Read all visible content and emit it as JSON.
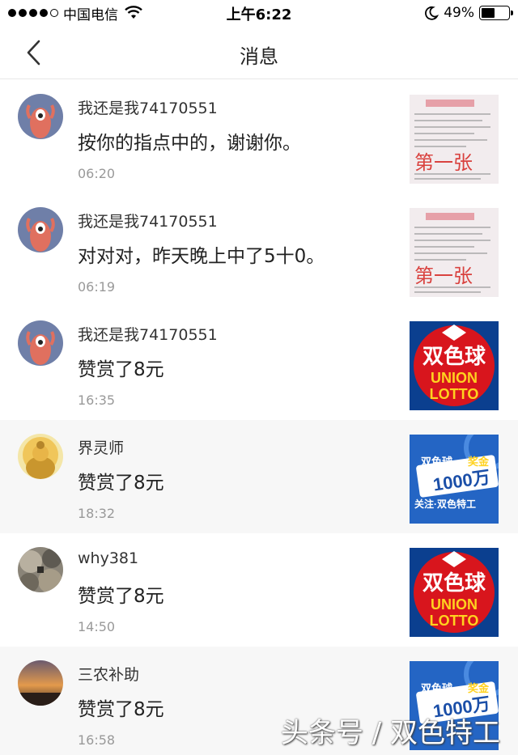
{
  "status_bar": {
    "carrier": "中国电信",
    "time": "上午6:22",
    "battery": "49%",
    "battery_level": 0.49
  },
  "nav": {
    "title": "消息"
  },
  "messages": [
    {
      "name": "我还是我74170551",
      "text": "按你的指点中的，谢谢你。",
      "time": "06:20",
      "thumb_text": "第一张"
    },
    {
      "name": "我还是我74170551",
      "text": "对对对，昨天晚上中了5十0。",
      "time": "06:19",
      "thumb_text": "第一张"
    },
    {
      "name": "我还是我74170551",
      "text": "赞赏了8元",
      "time": "16:35",
      "thumb_text_1": "双色球",
      "thumb_text_2": "UNION",
      "thumb_text_3": "LOTTO"
    },
    {
      "name": "界灵师",
      "text": "赞赏了8元",
      "time": "18:32",
      "thumb_text_1": "双色球",
      "thumb_text_2": "奖金",
      "thumb_text_3": "1000万",
      "thumb_text_4": "关注·双色特工"
    },
    {
      "name": "why381",
      "text": "赞赏了8元",
      "time": "14:50",
      "thumb_text_1": "双色球",
      "thumb_text_2": "UNION",
      "thumb_text_3": "LOTTO"
    },
    {
      "name": "三农补助",
      "text": "赞赏了8元",
      "time": "16:58",
      "thumb_text_1": "双色球",
      "thumb_text_2": "奖金",
      "thumb_text_3": "1000万"
    }
  ],
  "watermark": "头条号 / 双色特工",
  "colors": {
    "row_shade": "#f7f7f7",
    "text_secondary": "#999999",
    "union_red": "#d8151d",
    "ad_blue": "#2465c4"
  }
}
